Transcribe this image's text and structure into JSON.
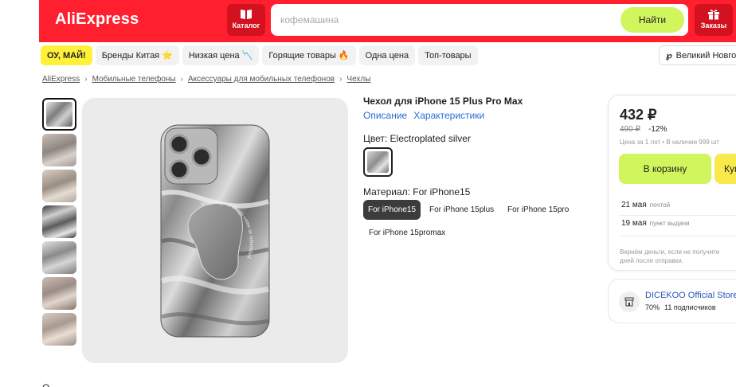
{
  "header": {
    "logo": "AliExpress",
    "catalog_label": "Каталог",
    "search_placeholder": "кофемашина",
    "search_button": "Найти",
    "orders_label": "Заказы",
    "brand_color": "#ff1f2e"
  },
  "promo_nav": {
    "items": [
      {
        "label": "ОУ, МАЙ!",
        "icon": ""
      },
      {
        "label": "Бренды Китая",
        "icon": "⭐"
      },
      {
        "label": "Низкая цена",
        "icon": "📉"
      },
      {
        "label": "Горящие товары",
        "icon": "🔥"
      },
      {
        "label": "Одна цена",
        "icon": ""
      },
      {
        "label": "Топ-товары",
        "icon": ""
      }
    ],
    "city": "Великий Новгород"
  },
  "breadcrumb": [
    "AliExpress",
    "Мобильные телефоны",
    "Аксессуары для мобильных телефонов",
    "Чехлы"
  ],
  "product": {
    "title": "Чехол для iPhone 15 Plus Pro Max",
    "tabs": [
      "Описание",
      "Характеристики"
    ],
    "color_label": "Цвет: Electroplated silver",
    "material_label": "Материал: For iPhone15",
    "materials": [
      "For iPhone15",
      "For iPhone 15plus",
      "For iPhone 15pro",
      "For iPhone 15promax"
    ],
    "selected_material": "For iPhone15",
    "case_text": "May all good things come as scheduled"
  },
  "buybox": {
    "price": "432 ₽",
    "old_price": "490 ₽",
    "discount": "-12%",
    "lot_info": "Цена за 1 лот • В наличии 999 шт",
    "cart_button": "В корзину",
    "buy_button": "Купить",
    "delivery": [
      {
        "date": "21 мая",
        "method": "почтой"
      },
      {
        "date": "19 мая",
        "method": "пункт выдачи"
      }
    ],
    "guarantee_line1": "Вернём деньги, если не получите",
    "guarantee_line2": "дней после отправки."
  },
  "store": {
    "name": "DICEKOO Official Store",
    "rating": "70%",
    "subscribers": "11 подписчиков"
  },
  "bottom_hint": "О"
}
